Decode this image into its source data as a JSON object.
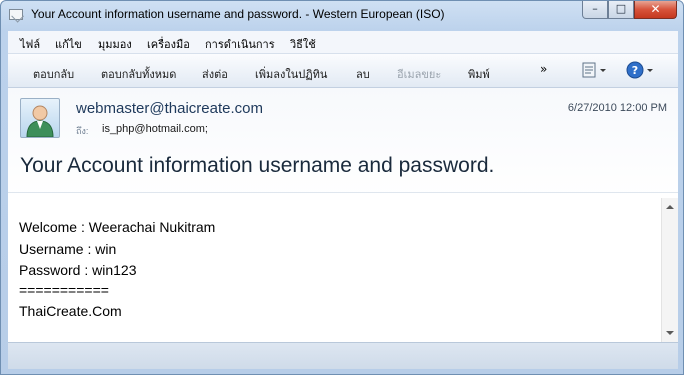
{
  "window": {
    "title": "Your Account information username and password. - Western European (ISO)",
    "minimize_glyph": "–",
    "maximize_glyph": "□",
    "close_glyph": "✕"
  },
  "menu": {
    "items": [
      "ไฟล์",
      "แก้ไข",
      "มุมมอง",
      "เครื่องมือ",
      "การดำเนินการ",
      "วิธีใช้"
    ]
  },
  "toolbar": {
    "reply": "ตอบกลับ",
    "reply_all": "ตอบกลับทั้งหมด",
    "forward": "ส่งต่อ",
    "add_to_calendar": "เพิ่มลงในปฏิทิน",
    "delete": "ลบ",
    "junk": "อีเมลขยะ",
    "print": "พิมพ์",
    "more": "»",
    "icons": [
      "addresses-icon",
      "help-icon"
    ]
  },
  "message": {
    "from": "webmaster@thaicreate.com",
    "date": "6/27/2010 12:00 PM",
    "to_label": "ถึง:",
    "to": "is_php@hotmail.com;",
    "subject": "Your Account information username and password.",
    "body_lines": [
      "Welcome : Weerachai Nukitram",
      "Username : win",
      "Password : win123",
      "===========",
      "ThaiCreate.Com"
    ]
  },
  "colors": {
    "frame": "#b7cde8",
    "from_text": "#1e395b",
    "close_button": "#c5381f"
  }
}
